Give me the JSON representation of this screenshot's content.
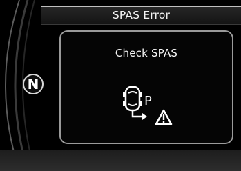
{
  "header": {
    "title": "SPAS Error"
  },
  "panel": {
    "message": "Check SPAS",
    "icon": "spas-warning-icon",
    "icon_letter": "P"
  },
  "gauge": {
    "gear": "N"
  },
  "colors": {
    "background": "#000000",
    "text": "#f5f5f5",
    "panel_border": "#9a9a9a"
  }
}
